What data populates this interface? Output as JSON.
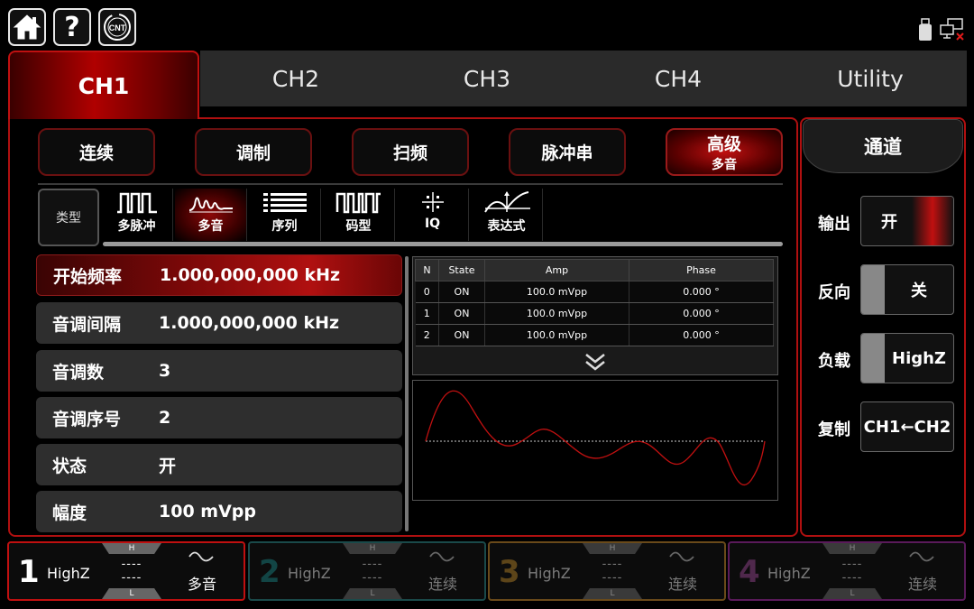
{
  "topbar": {
    "help_label": "?",
    "logo_text": "CNT"
  },
  "tabs": [
    {
      "label": "CH1",
      "active": true
    },
    {
      "label": "CH2",
      "active": false
    },
    {
      "label": "CH3",
      "active": false
    },
    {
      "label": "CH4",
      "active": false
    },
    {
      "label": "Utility",
      "active": false
    }
  ],
  "modes": [
    {
      "label": "连续"
    },
    {
      "label": "调制"
    },
    {
      "label": "扫频"
    },
    {
      "label": "脉冲串"
    },
    {
      "label": "高级",
      "sub": "多音",
      "active": true
    }
  ],
  "type_row": {
    "label": "类型",
    "items": [
      {
        "label": "多脉冲",
        "icon": "multi-pulse-icon"
      },
      {
        "label": "多音",
        "icon": "multi-tone-icon",
        "active": true
      },
      {
        "label": "序列",
        "icon": "sequence-icon"
      },
      {
        "label": "码型",
        "icon": "pattern-icon"
      },
      {
        "label": "IQ",
        "icon": "iq-icon"
      },
      {
        "label": "表达式",
        "icon": "expression-icon"
      }
    ]
  },
  "params": [
    {
      "name": "开始频率",
      "value": "1.000,000,000 kHz",
      "active": true
    },
    {
      "name": "音调间隔",
      "value": "1.000,000,000 kHz"
    },
    {
      "name": "音调数",
      "value": "3"
    },
    {
      "name": "音调序号",
      "value": "2"
    },
    {
      "name": "状态",
      "value": "开"
    },
    {
      "name": "幅度",
      "value": "100 mVpp"
    }
  ],
  "tone_table": {
    "headers": [
      "N",
      "State",
      "Amp",
      "Phase"
    ],
    "rows": [
      [
        "0",
        "ON",
        "100.0 mVpp",
        "0.000 °"
      ],
      [
        "1",
        "ON",
        "100.0 mVpp",
        "0.000 °"
      ],
      [
        "2",
        "ON",
        "100.0 mVpp",
        "0.000 °"
      ]
    ]
  },
  "right_panel": {
    "title": "通道",
    "output_label": "输出",
    "output_value": "开",
    "invert_label": "反向",
    "invert_value": "关",
    "load_label": "负载",
    "load_value": "HighZ",
    "copy_label": "复制",
    "copy_value": "CH1←CH2"
  },
  "channels": [
    {
      "num": "1",
      "load": "HighZ",
      "h": "H",
      "l": "L",
      "dash1": "----",
      "dash2": "----",
      "mode": "多音",
      "color": "#e01a1a",
      "active": true
    },
    {
      "num": "2",
      "load": "HighZ",
      "h": "H",
      "l": "L",
      "dash1": "----",
      "dash2": "----",
      "mode": "连续",
      "color": "#1a6a6a"
    },
    {
      "num": "3",
      "load": "HighZ",
      "h": "H",
      "l": "L",
      "dash1": "----",
      "dash2": "----",
      "mode": "连续",
      "color": "#a06a1a"
    },
    {
      "num": "4",
      "load": "HighZ",
      "h": "H",
      "l": "L",
      "dash1": "----",
      "dash2": "----",
      "mode": "连续",
      "color": "#8a2a7a"
    }
  ],
  "colors": {
    "accent": "#b01010",
    "wave": "#c01010"
  }
}
